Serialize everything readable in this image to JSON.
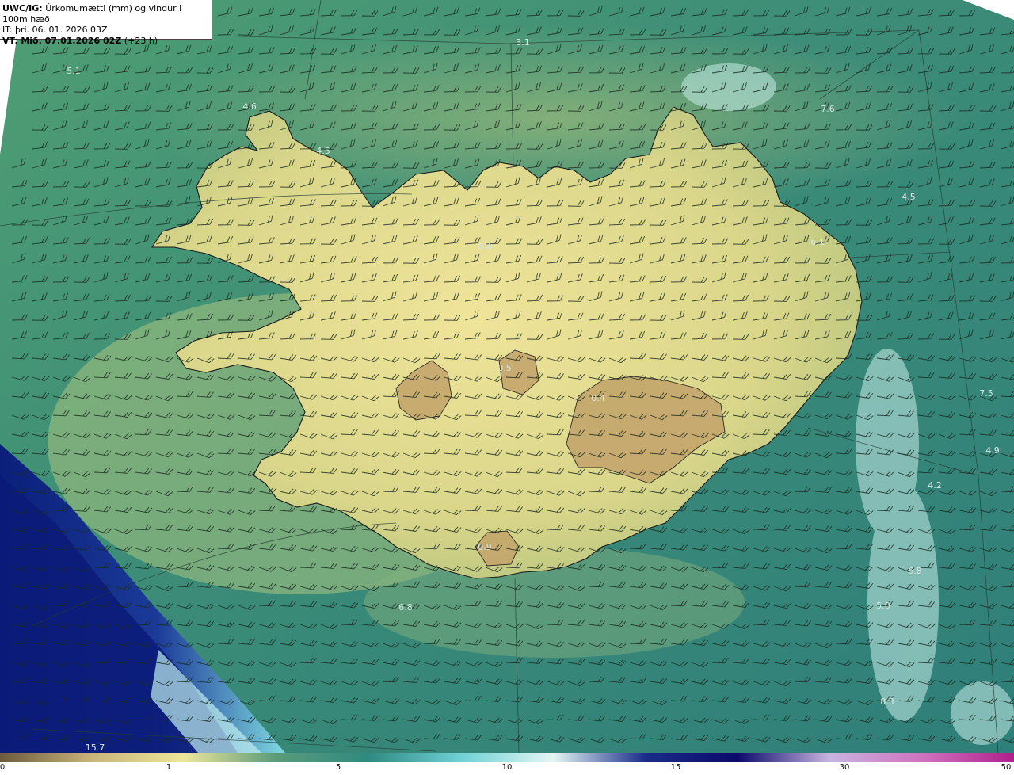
{
  "header": {
    "model_label": "UWC/IG:",
    "title": "Úrkomumætti (mm) og vindur i 100m hæð",
    "it_line": "IT: þri. 06. 01. 2026 03Z",
    "vt_label": "VT:",
    "vt_text": "Mið. 07.01.2026 02Z",
    "vt_offset": "(+23 h)"
  },
  "map_values": [
    {
      "text": "5.1"
    },
    {
      "text": "3.1"
    },
    {
      "text": "4.6"
    },
    {
      "text": "4.5"
    },
    {
      "text": "7.6"
    },
    {
      "text": "4.5"
    },
    {
      "text": "6.1"
    },
    {
      "text": "7.5"
    },
    {
      "text": "4.9"
    },
    {
      "text": "4.2"
    },
    {
      "text": "6.8"
    },
    {
      "text": "5.0"
    },
    {
      "text": "8.3"
    },
    {
      "text": "6.8"
    },
    {
      "text": "15.7"
    },
    {
      "text": "0.5"
    },
    {
      "text": "0.4"
    },
    {
      "text": "0.4"
    },
    {
      "text": "0.9"
    }
  ],
  "colorbar": {
    "ticks": [
      "0",
      "1",
      "5",
      "10",
      "15",
      "30",
      "50"
    ],
    "colors": [
      "#6b5a3e",
      "#c9b57a",
      "#ece69a",
      "#5a9a7a",
      "#2f8a80",
      "#6fd0d6",
      "#e4f6f4",
      "#1a2d88",
      "#0a0a6a",
      "#c8b4e0",
      "#d072c0",
      "#b0208a"
    ]
  },
  "colors": {
    "sea": "#3f8f7a",
    "land": "#e6e08e",
    "coast": "#1a1a1a"
  }
}
